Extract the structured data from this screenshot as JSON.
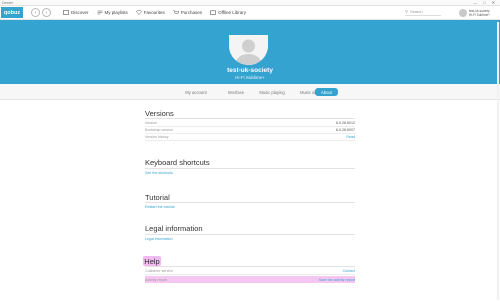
{
  "window": {
    "title": "Deezer",
    "controls": [
      "—",
      "□",
      "✕"
    ]
  },
  "topbar": {
    "logo": "qobuz",
    "back": "‹",
    "forward": "›",
    "nav": [
      {
        "label": "Discover",
        "icon": "discover-icon"
      },
      {
        "label": "My playlists",
        "icon": "playlist-icon"
      },
      {
        "label": "Favourites",
        "icon": "heart-icon"
      },
      {
        "label": "Purchases",
        "icon": "cart-icon"
      },
      {
        "label": "Offline Library",
        "icon": "offline-icon"
      }
    ],
    "search_placeholder": "Search",
    "user": {
      "name": "test-uk-society",
      "sub": "Hi-Fi Sublime+"
    }
  },
  "profile": {
    "name": "test-uk-society",
    "subscription": "Hi-Fi Sublime+",
    "modify_label": "Modify my account"
  },
  "tabs": [
    "My account",
    "Interface",
    "Music playing",
    "Music download",
    "About"
  ],
  "active_tab": "About",
  "versions": {
    "title": "Versions",
    "rows": [
      {
        "label": "Version",
        "value": "6.0.28.6012"
      },
      {
        "label": "Bootstrap version",
        "value": "6.0.28.6007"
      },
      {
        "label": "Version history",
        "value": "Read"
      }
    ]
  },
  "shortcuts": {
    "title": "Keyboard shortcuts",
    "link": "See the shortcuts"
  },
  "tutorial": {
    "title": "Tutorial",
    "link": "Restart the tutorial"
  },
  "legal": {
    "title": "Legal information",
    "link": "Legal information"
  },
  "help": {
    "title": "Help",
    "rows": [
      {
        "label": "Customer service",
        "value": "Contact"
      },
      {
        "label": "Activity report",
        "value": "Save the activity report"
      }
    ]
  }
}
